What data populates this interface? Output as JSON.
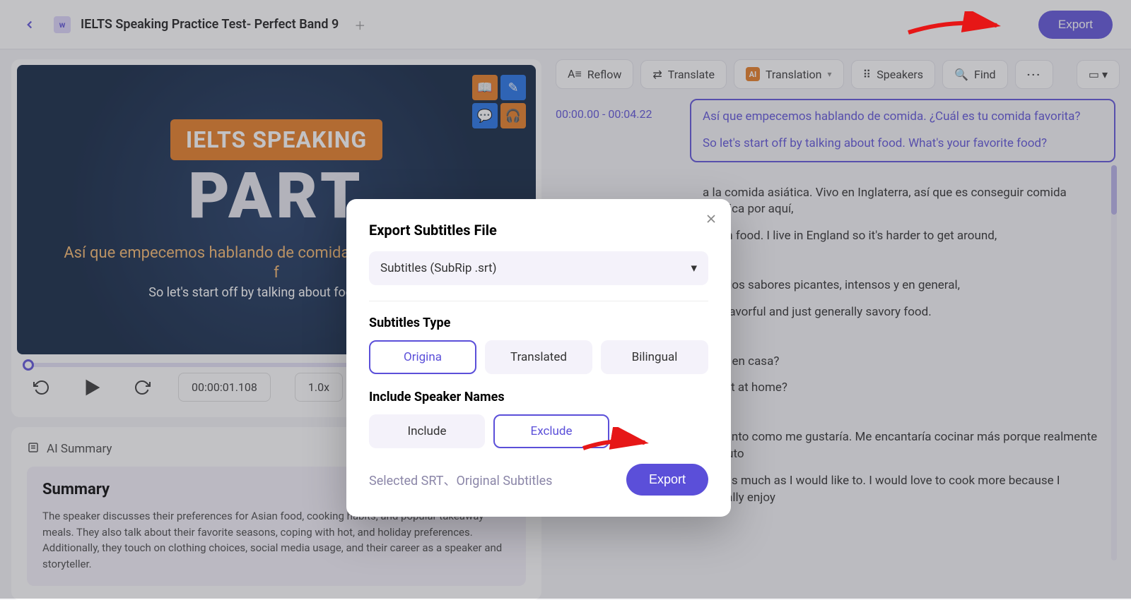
{
  "header": {
    "title": "IELTS Speaking Practice Test- Perfect Band 9",
    "export_label": "Export",
    "doc_initial": "w"
  },
  "video": {
    "badge_text": "IELTS SPEAKING",
    "part_text": "PART",
    "subtitle_es": "Así que empecemos hablando de comida. ¿Cuál es tu comida f",
    "subtitle_en": "So let's start off by talking about food. What's",
    "timecode": "00:00:01.108",
    "speed": "1.0x"
  },
  "summary": {
    "heading_label": "AI Summary",
    "title": "Summary",
    "body": "The speaker discusses their preferences for Asian food, cooking habits, and popular takeaway meals. They also talk about their favorite seasons, coping with hot, and holiday preferences. Additionally, they touch on clothing choices, social media usage, and their career as a speaker and storyteller."
  },
  "toolbar": {
    "reflow": "Reflow",
    "translate": "Translate",
    "translation": "Translation",
    "speakers": "Speakers",
    "find": "Find"
  },
  "transcript": [
    {
      "time": "00:00.00 - 00:04.22",
      "es": "Así que empecemos hablando de comida. ¿Cuál es tu comida favorita?",
      "en": "So let's start off by talking about food. What's your favorite food?",
      "active": true
    },
    {
      "time": "",
      "es": "a la comida asiática. Vivo en Inglaterra, así que es conseguir comida asiática por aquí,",
      "en": "Asian food. I live in England so it's harder to get around,",
      "active": false
    },
    {
      "time": "",
      "es": "stan los sabores picantes, intensos y en general,",
      "en": "icy, flavorful and just generally savory food.",
      "active": false
    },
    {
      "time": "",
      "es": "ucho en casa?",
      "en": "k a lot at home?",
      "active": false
    },
    {
      "time": "",
      "es": "No tanto como me gustaría. Me encantaría cocinar más porque realmente disfruto",
      "en": "Not as much as I would like to. I would love to cook more because I actually enjoy",
      "active": false
    }
  ],
  "modal": {
    "title": "Export Subtitles File",
    "select_value": "Subtitles (SubRip .srt)",
    "type_label": "Subtitles Type",
    "type_options": [
      "Origina",
      "Translated",
      "Bilingual"
    ],
    "type_selected_index": 0,
    "speaker_label": "Include Speaker Names",
    "speaker_options": [
      "Include",
      "Exclude"
    ],
    "speaker_selected_index": 1,
    "summary_text": "Selected SRT、Original Subtitles",
    "export_label": "Export"
  }
}
